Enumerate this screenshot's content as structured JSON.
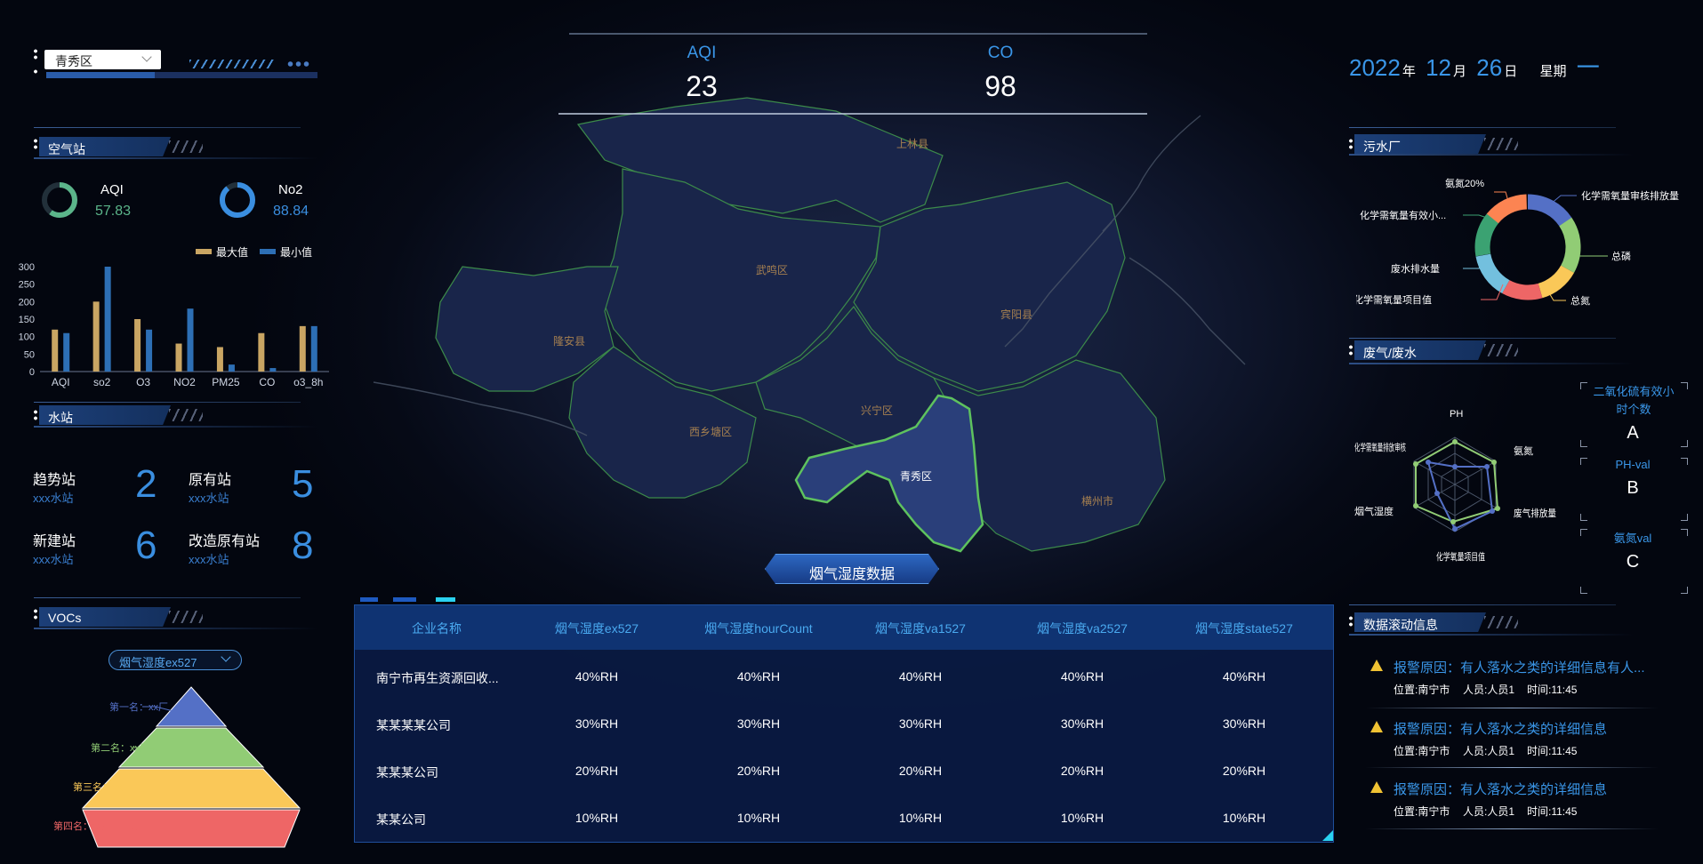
{
  "district_select": {
    "value": "青秀区"
  },
  "top_metrics": [
    {
      "label": "AQI",
      "value": "23"
    },
    {
      "label": "CO",
      "value": "98"
    }
  ],
  "date": {
    "year": "2022",
    "year_unit": "年",
    "month": "12",
    "month_unit": "月",
    "day": "26",
    "day_unit": "日",
    "weekday_label": "星期",
    "weekday": "一"
  },
  "air_station": {
    "title": "空气站",
    "gauges": [
      {
        "label": "AQI",
        "value": "57.83",
        "color": "#5bb58a"
      },
      {
        "label": "No2",
        "value": "88.84",
        "color": "#3a8ee0"
      }
    ],
    "legend": [
      {
        "name": "最大值",
        "color": "#c9a563"
      },
      {
        "name": "最小值",
        "color": "#2d6fb5"
      }
    ]
  },
  "chart_data": {
    "type": "bar",
    "categories": [
      "AQI",
      "so2",
      "O3",
      "NO2",
      "PM25",
      "CO",
      "o3_8h"
    ],
    "series": [
      {
        "name": "最大值",
        "values": [
          120,
          200,
          150,
          80,
          70,
          110,
          130
        ]
      },
      {
        "name": "最小值",
        "values": [
          110,
          300,
          120,
          180,
          20,
          10,
          130
        ]
      }
    ],
    "ylim": [
      0,
      300
    ],
    "yticks": [
      "0",
      "50",
      "100",
      "150",
      "200",
      "250",
      "300"
    ],
    "grid": false,
    "legend_position": "top-right"
  },
  "water_station": {
    "title": "水站",
    "items": [
      {
        "name": "趋势站",
        "sub": "xxx水站",
        "count": "2"
      },
      {
        "name": "原有站",
        "sub": "xxx水站",
        "count": "5"
      },
      {
        "name": "新建站",
        "sub": "xxx水站",
        "count": "6"
      },
      {
        "name": "改造原有站",
        "sub": "xxx水站",
        "count": "8"
      }
    ]
  },
  "vocs": {
    "title": "VOCs",
    "select": "烟气湿度ex527",
    "levels": [
      {
        "label": "第一名：xx厂",
        "color": "#5470c6"
      },
      {
        "label": "第二名：xx厂",
        "color": "#91cc75"
      },
      {
        "label": "第三名：xx厂",
        "color": "#fac858"
      },
      {
        "label": "第四名：xx厂",
        "color": "#ee6666"
      }
    ]
  },
  "map": {
    "regions": [
      "上林县",
      "武鸣区",
      "宾阳县",
      "隆安县",
      "兴宁区",
      "西乡塘区",
      "青秀区",
      "横州市"
    ],
    "selected": "青秀区"
  },
  "table": {
    "title": "烟气湿度数据",
    "columns": [
      "企业名称",
      "烟气湿度ex527",
      "烟气湿度hourCount",
      "烟气湿度va1527",
      "烟气湿度va2527",
      "烟气湿度state527"
    ],
    "rows": [
      [
        "南宁市再生资源回收...",
        "40%RH",
        "40%RH",
        "40%RH",
        "40%RH",
        "40%RH"
      ],
      [
        "某某某某公司",
        "30%RH",
        "30%RH",
        "30%RH",
        "30%RH",
        "30%RH"
      ],
      [
        "某某某公司",
        "20%RH",
        "20%RH",
        "20%RH",
        "20%RH",
        "20%RH"
      ],
      [
        "某某公司",
        "10%RH",
        "10%RH",
        "10%RH",
        "10%RH",
        "10%RH"
      ]
    ]
  },
  "sewage": {
    "title": "污水厂",
    "donut_labels": [
      "化学需氧量审核排放量",
      "总磷",
      "总氮",
      "化学需氧量项目值",
      "废水排水量",
      "化学需氧量有效小...",
      "氨氮20%"
    ],
    "donut_colors": [
      "#5470c6",
      "#91cc75",
      "#fac858",
      "#ee6666",
      "#73c0de",
      "#3ba272",
      "#fc8452"
    ]
  },
  "wastegas": {
    "title": "废气/废水",
    "radar_labels": [
      "PH",
      "氨氮",
      "废气排放量",
      "化学氧量项目值",
      "烟气湿度",
      "化学需氧量排放审核"
    ],
    "readouts": [
      {
        "label": "二氧化硫有效小时个数",
        "value": "A"
      },
      {
        "label": "PH-val",
        "value": "B"
      },
      {
        "label": "氨氮val",
        "value": "C"
      }
    ]
  },
  "scroll_info": {
    "title": "数据滚动信息",
    "items": [
      {
        "title": "报警原因：有人落水之类的详细信息有人...",
        "location": "位置:南宁市",
        "person": "人员:人员1",
        "time": "时间:11:45"
      },
      {
        "title": "报警原因：有人落水之类的详细信息",
        "location": "位置:南宁市",
        "person": "人员:人员1",
        "time": "时间:11:45"
      },
      {
        "title": "报警原因：有人落水之类的详细信息",
        "location": "位置:南宁市",
        "person": "人员:人员1",
        "time": "时间:11:45"
      }
    ]
  }
}
